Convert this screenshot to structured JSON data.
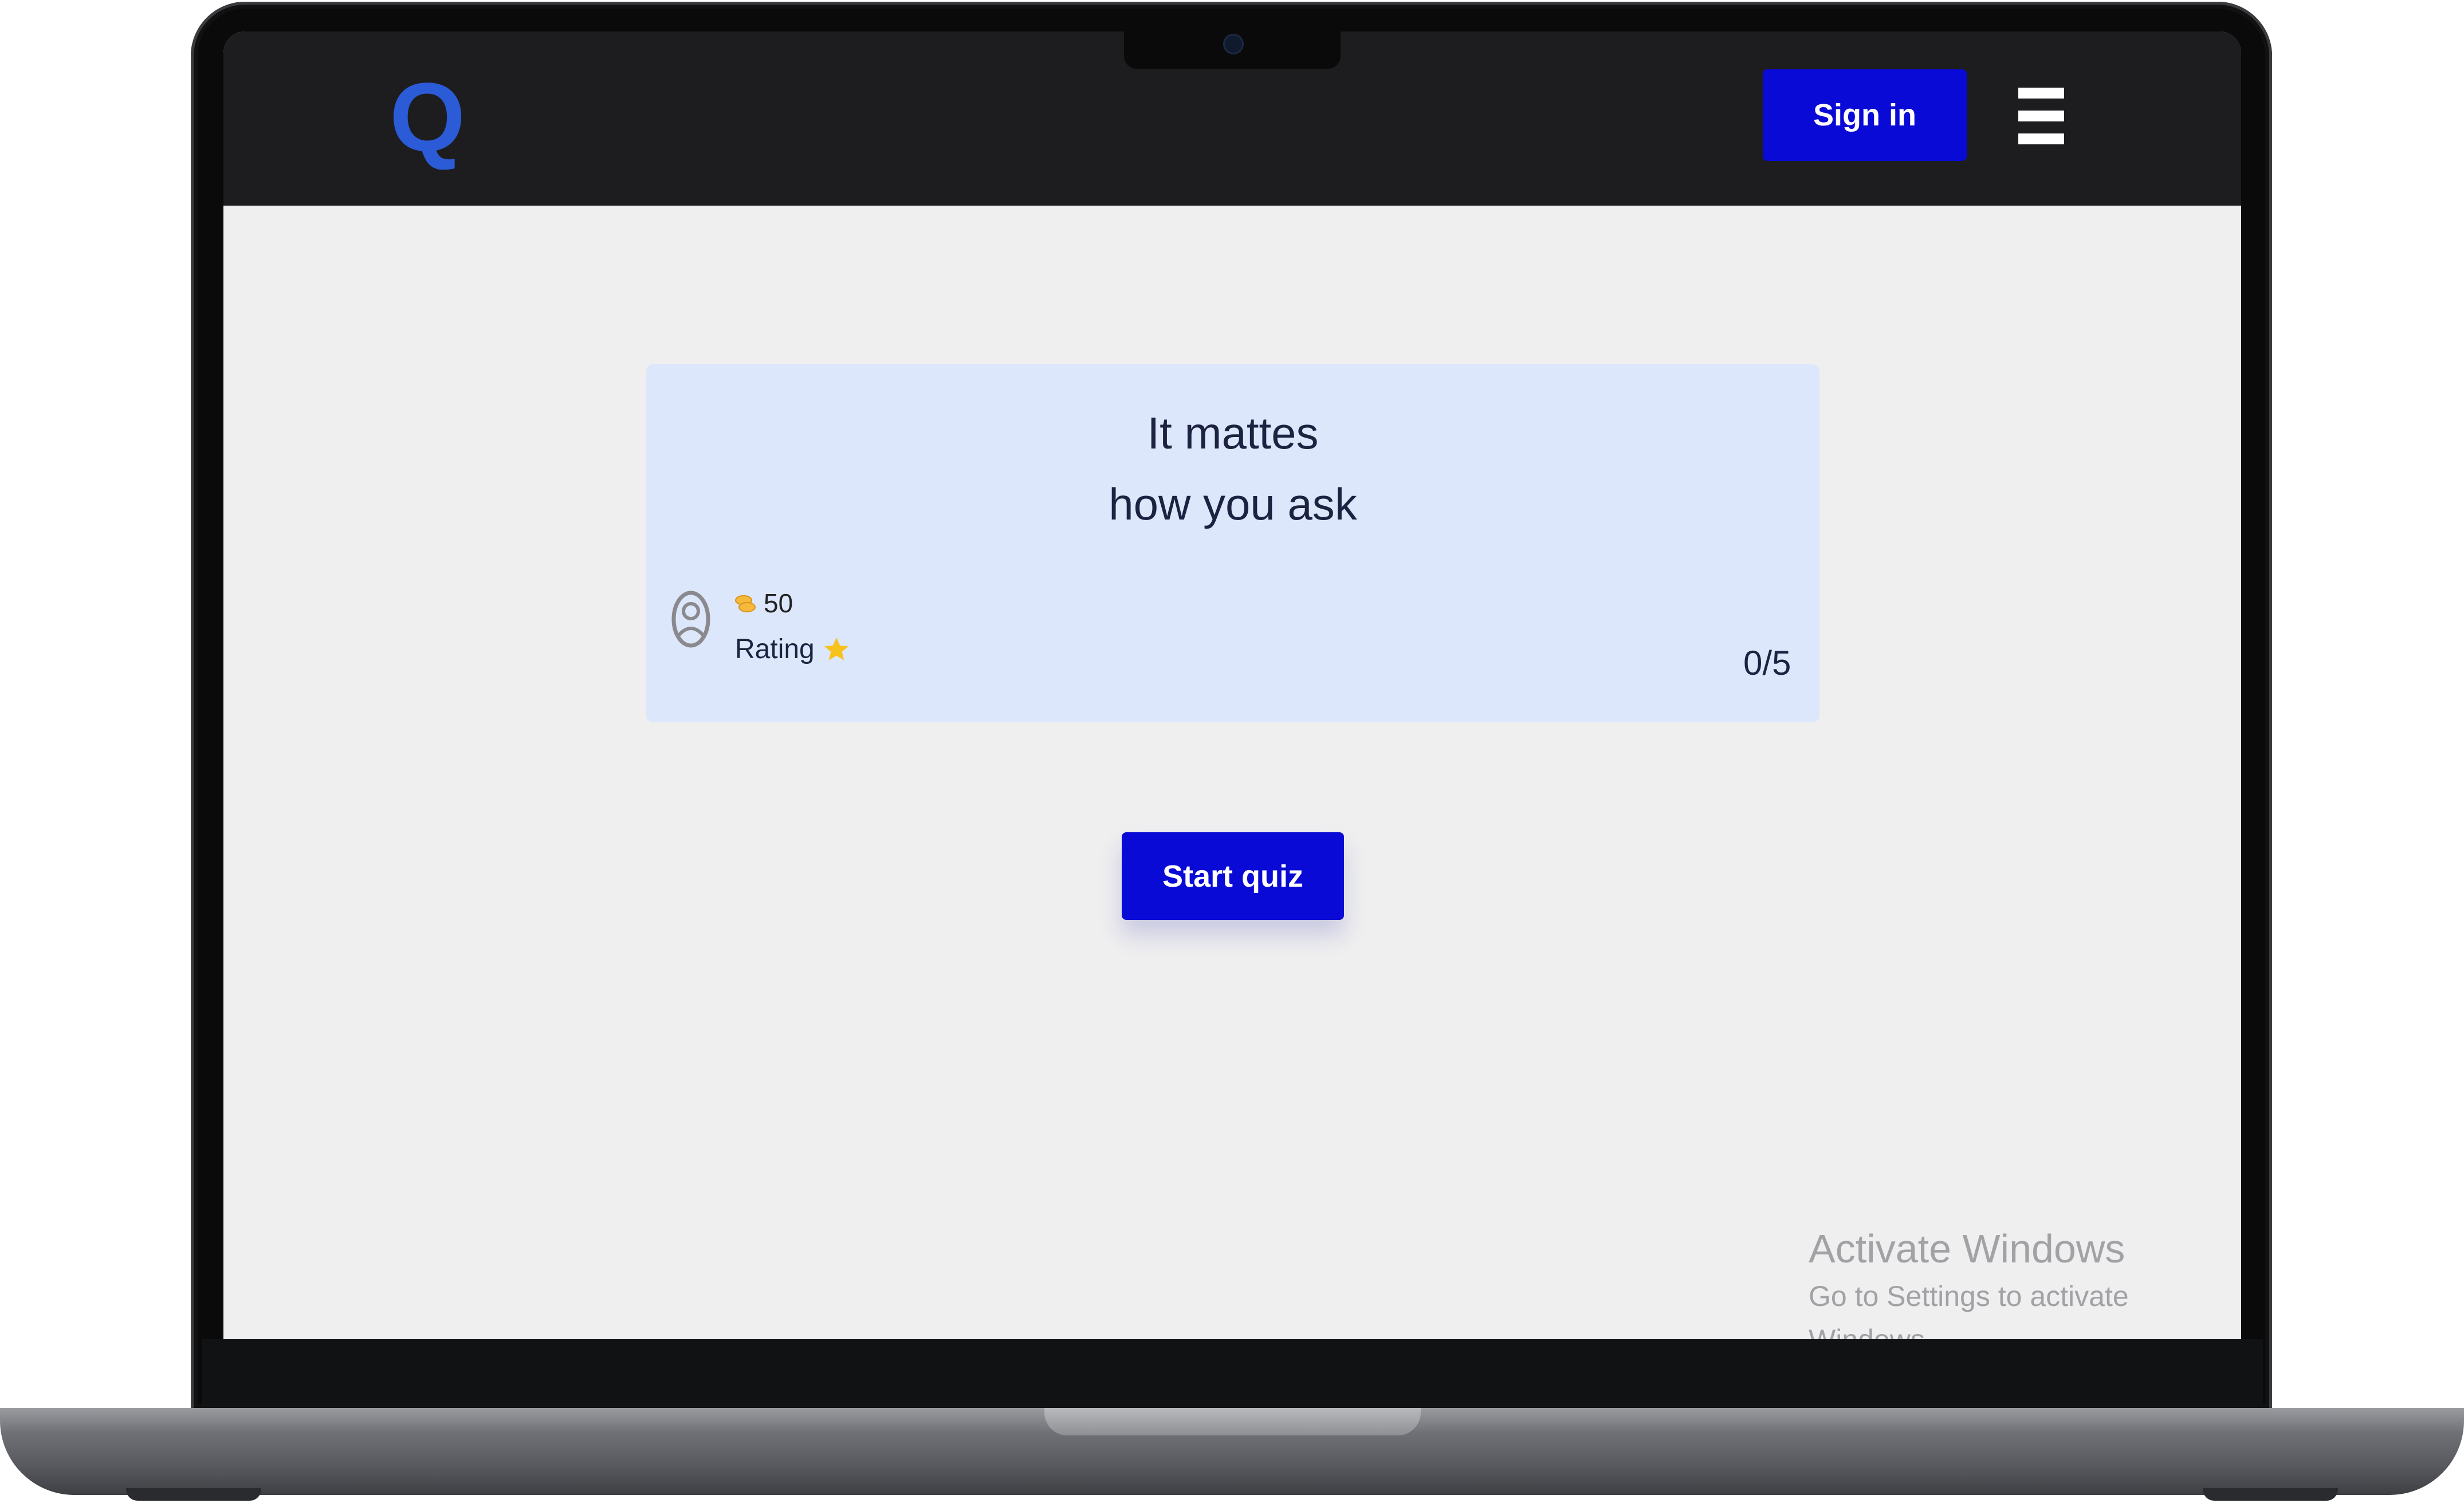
{
  "header": {
    "logo_text": "Q",
    "signin_label": "Sign in",
    "menu_icon": "hamburger-menu-icon",
    "accent_color": "#0a0ad6",
    "logo_color": "#2b5bd7"
  },
  "quiz": {
    "title_line1": "It mattes",
    "title_line2": "how you ask",
    "coins": "50",
    "rating_label": "Rating",
    "progress": "0/5",
    "card_color": "#dde7fb"
  },
  "actions": {
    "start_label": "Start quiz"
  },
  "watermark": {
    "title": "Activate Windows",
    "subtitle": "Go to Settings to activate Windows."
  }
}
